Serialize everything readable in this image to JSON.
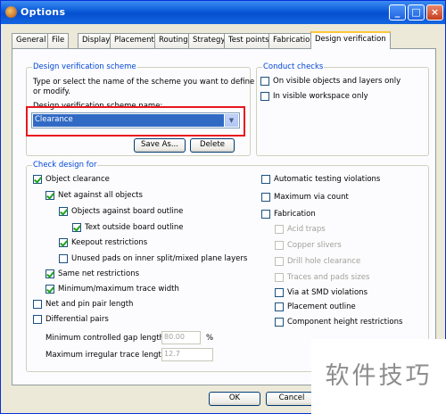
{
  "window": {
    "title": "Options"
  },
  "title_buttons": {
    "minimize": "_",
    "maximize": "□",
    "close": "×"
  },
  "tabs": [
    {
      "label": "General"
    },
    {
      "label": "File"
    },
    {
      "label": "Display"
    },
    {
      "label": "Placement"
    },
    {
      "label": "Routing"
    },
    {
      "label": "Strategy"
    },
    {
      "label": "Test points"
    },
    {
      "label": "Fabrication"
    },
    {
      "label": "Design verification",
      "active": true
    }
  ],
  "scheme": {
    "title": "Design verification scheme",
    "description_line1": "Type or select the name of the scheme you want to define",
    "description_line2": "or modify.",
    "name_label": "Design verification scheme name:",
    "selected": "Clearance",
    "save_as": "Save As...",
    "delete": "Delete"
  },
  "conduct": {
    "title": "Conduct checks",
    "on_visible": "On visible objects and layers only",
    "in_visible_workspace": "In visible workspace only"
  },
  "check": {
    "title": "Check design for",
    "object_clearance": "Object clearance",
    "net_against_all": "Net against all objects",
    "objects_board_outline": "Objects against board outline",
    "text_outside_board": "Text outside board outline",
    "keepout": "Keepout restrictions",
    "unused_pads": "Unused pads on inner split/mixed plane layers",
    "same_net": "Same net restrictions",
    "min_max_trace": "Minimum/maximum trace width",
    "net_pin_pair": "Net and pin pair length",
    "differential": "Differential pairs",
    "min_gap_label": "Minimum controlled gap length:",
    "min_gap_value": "80.00",
    "min_gap_unit": "%",
    "max_irregular_label": "Maximum irregular trace length:",
    "max_irregular_value": "12.7",
    "auto_testing": "Automatic testing violations",
    "max_via": "Maximum via count",
    "fabrication": "Fabrication",
    "acid_traps": "Acid traps",
    "copper_slivers": "Copper slivers",
    "drill_hole": "Drill hole clearance",
    "traces_pads_sizes": "Traces and pads sizes",
    "via_smd": "Via at SMD violations",
    "placement_outline": "Placement outline",
    "component_height": "Component height restrictions"
  },
  "footer": {
    "ok": "OK",
    "cancel": "Cancel"
  },
  "watermark": "软件技巧",
  "colors": {
    "title_bar": "#0a5ad7",
    "selection": "#316ac5",
    "group_title": "#0046d5",
    "highlight_box": "#e8171e"
  }
}
